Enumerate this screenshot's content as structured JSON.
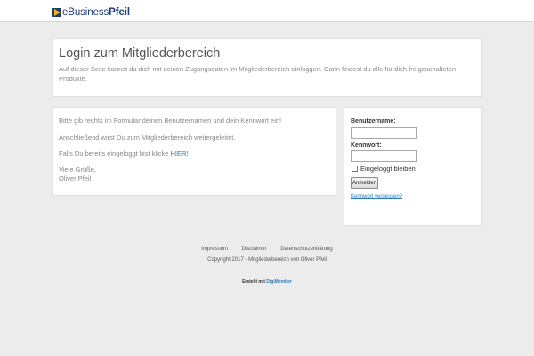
{
  "header": {
    "logo_prefix": "eBusiness",
    "logo_suffix": "Pfeil"
  },
  "intro": {
    "title": "Login zum Mitgliederbereich",
    "description": "Auf dieser Seite kannst du dich mit deinen Zugangsdaten im Mitgliederbereich einloggen. Darin findest du alle für dich freigeschalteten Produkte."
  },
  "info": {
    "line1": "Bitte gib rechts im Formular deinen Benutzernamen und dein Kennwort ein!",
    "line2": "Anschließend wirst Du zum Mitgliederbereich weitergeleitet.",
    "line3_prefix": "Falls Du bereits eingeloggt bist klicke ",
    "line3_link": "HIER",
    "line3_suffix": "!",
    "greeting": "Viele Grüße,",
    "signature": "Oliver Pfeil"
  },
  "login": {
    "username_label": "Benutzername:",
    "username_value": "",
    "password_label": "Kennwort:",
    "password_value": "",
    "remember_label": "Eingeloggt bleiben",
    "remember_checked": false,
    "submit_label": "Anmelden",
    "forgot_link": "Kennwort vergessen?"
  },
  "footer": {
    "links": [
      "Impressum",
      "Disclaimer",
      "Datenschutzerklärung"
    ],
    "copyright": "Copyright 2017 - Mitgliederbereich von Oliver Pfeil",
    "created_prefix": "Erstellt mit ",
    "created_brand": "DigiMember"
  },
  "colors": {
    "background": "#ececec",
    "brand_blue": "#1d3c78",
    "brand_yellow": "#f2b705",
    "link": "#2a7bb7"
  }
}
